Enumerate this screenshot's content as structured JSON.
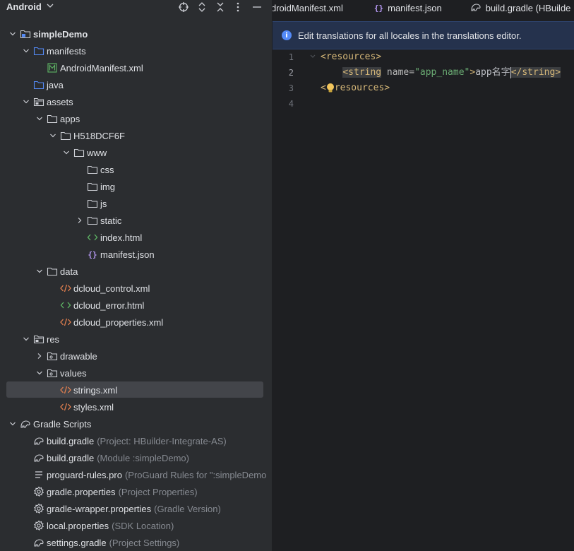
{
  "project_panel": {
    "view_title": "Android",
    "tree": [
      {
        "depth": 0,
        "arrow": "down",
        "icon": "module",
        "label": "simpleDemo",
        "bold": true
      },
      {
        "depth": 1,
        "arrow": "down",
        "icon": "folder-blue",
        "label": "manifests"
      },
      {
        "depth": 2,
        "arrow": "none",
        "icon": "manifest",
        "label": "AndroidManifest.xml"
      },
      {
        "depth": 1,
        "arrow": "none",
        "icon": "folder-blue",
        "label": "java"
      },
      {
        "depth": 1,
        "arrow": "down",
        "icon": "folder-res",
        "label": "assets"
      },
      {
        "depth": 2,
        "arrow": "down",
        "icon": "folder",
        "label": "apps"
      },
      {
        "depth": 3,
        "arrow": "down",
        "icon": "folder",
        "label": "H518DCF6F"
      },
      {
        "depth": 4,
        "arrow": "down",
        "icon": "folder",
        "label": "www"
      },
      {
        "depth": 5,
        "arrow": "none",
        "icon": "folder",
        "label": "css"
      },
      {
        "depth": 5,
        "arrow": "none",
        "icon": "folder",
        "label": "img"
      },
      {
        "depth": 5,
        "arrow": "none",
        "icon": "folder",
        "label": "js"
      },
      {
        "depth": 5,
        "arrow": "right",
        "icon": "folder",
        "label": "static"
      },
      {
        "depth": 5,
        "arrow": "none",
        "icon": "html",
        "label": "index.html"
      },
      {
        "depth": 5,
        "arrow": "none",
        "icon": "json",
        "label": "manifest.json"
      },
      {
        "depth": 2,
        "arrow": "down",
        "icon": "folder",
        "label": "data"
      },
      {
        "depth": 3,
        "arrow": "none",
        "icon": "xml",
        "label": "dcloud_control.xml"
      },
      {
        "depth": 3,
        "arrow": "none",
        "icon": "html",
        "label": "dcloud_error.html"
      },
      {
        "depth": 3,
        "arrow": "none",
        "icon": "xml",
        "label": "dcloud_properties.xml"
      },
      {
        "depth": 1,
        "arrow": "down",
        "icon": "folder-res",
        "label": "res"
      },
      {
        "depth": 2,
        "arrow": "right",
        "icon": "folder-pkg",
        "label": "drawable"
      },
      {
        "depth": 2,
        "arrow": "down",
        "icon": "folder-pkg",
        "label": "values"
      },
      {
        "depth": 3,
        "arrow": "none",
        "icon": "xml",
        "label": "strings.xml",
        "selected": true
      },
      {
        "depth": 3,
        "arrow": "none",
        "icon": "xml",
        "label": "styles.xml"
      },
      {
        "depth": 0,
        "arrow": "down",
        "icon": "gradle",
        "label": "Gradle Scripts"
      },
      {
        "depth": 1,
        "arrow": "none",
        "icon": "gradle",
        "label": "build.gradle",
        "hint": "(Project: HBuilder-Integrate-AS)"
      },
      {
        "depth": 1,
        "arrow": "none",
        "icon": "gradle",
        "label": "build.gradle",
        "hint": "(Module :simpleDemo)"
      },
      {
        "depth": 1,
        "arrow": "none",
        "icon": "lines",
        "label": "proguard-rules.pro",
        "hint": "(ProGuard Rules for \":simpleDemo"
      },
      {
        "depth": 1,
        "arrow": "none",
        "icon": "gear",
        "label": "gradle.properties",
        "hint": "(Project Properties)"
      },
      {
        "depth": 1,
        "arrow": "none",
        "icon": "gear",
        "label": "gradle-wrapper.properties",
        "hint": "(Gradle Version)"
      },
      {
        "depth": 1,
        "arrow": "none",
        "icon": "gear",
        "label": "local.properties",
        "hint": "(SDK Location)"
      },
      {
        "depth": 1,
        "arrow": "none",
        "icon": "gradle",
        "label": "settings.gradle",
        "hint": "(Project Settings)"
      }
    ]
  },
  "editor": {
    "tabs": [
      {
        "icon": "none",
        "label": "droidManifest.xml"
      },
      {
        "icon": "json",
        "label": "manifest.json"
      },
      {
        "icon": "gradle",
        "label": "build.gradle (HBuilde"
      }
    ],
    "banner_text": "Edit translations for all locales in the translations editor.",
    "line_numbers": [
      "1",
      "2",
      "3",
      "4"
    ],
    "code": {
      "l1_tag": "<resources>",
      "l2_indent": "    ",
      "l2_open": "<string",
      "l2_attr": " name",
      "l2_eq": "=",
      "l2_val": "\"app_name\"",
      "l2_gt": ">",
      "l2_text_a": "app名",
      "l2_text_b": "字",
      "l2_close": "</string>",
      "l3_lt": "<",
      "l3_rest": "resources>"
    },
    "colors": {
      "accent": "#548af7",
      "tag": "#d5b778",
      "value": "#6aab73"
    }
  }
}
